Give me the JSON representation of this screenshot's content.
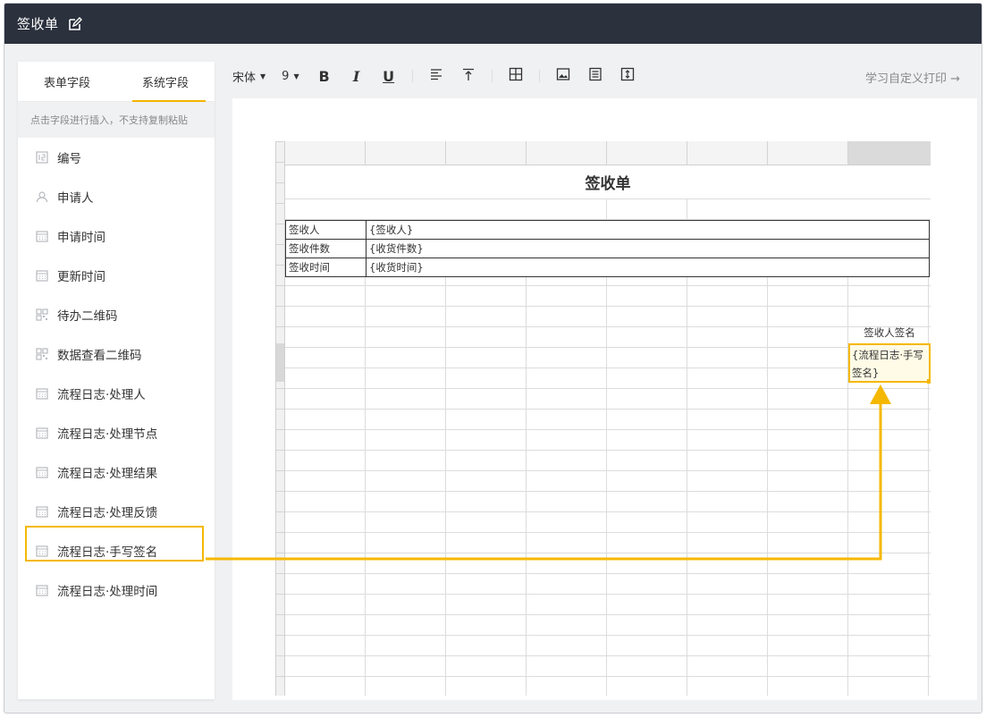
{
  "window": {
    "title": "签收单"
  },
  "sidebar": {
    "tabs": [
      {
        "label": "表单字段",
        "active": false
      },
      {
        "label": "系统字段",
        "active": true
      }
    ],
    "hint": "点击字段进行插入，不支持复制粘贴",
    "items": [
      {
        "label": "编号",
        "icon": "number-icon"
      },
      {
        "label": "申请人",
        "icon": "user-icon"
      },
      {
        "label": "申请时间",
        "icon": "calendar-icon"
      },
      {
        "label": "更新时间",
        "icon": "calendar-icon"
      },
      {
        "label": "待办二维码",
        "icon": "qrcode-icon"
      },
      {
        "label": "数据查看二维码",
        "icon": "qrcode-icon"
      },
      {
        "label": "流程日志·处理人",
        "icon": "calendar-icon"
      },
      {
        "label": "流程日志·处理节点",
        "icon": "calendar-icon"
      },
      {
        "label": "流程日志·处理结果",
        "icon": "calendar-icon"
      },
      {
        "label": "流程日志·处理反馈",
        "icon": "calendar-icon"
      },
      {
        "label": "流程日志·手写签名",
        "icon": "calendar-icon",
        "highlighted": true
      },
      {
        "label": "流程日志·处理时间",
        "icon": "calendar-icon"
      }
    ]
  },
  "toolbar": {
    "font_family": "宋体",
    "font_size": "9",
    "bold": "B",
    "italic": "I",
    "underline": "U",
    "learn_link": "学习自定义打印 →"
  },
  "sheet": {
    "title": "签收单",
    "rows": [
      {
        "label": "签收人",
        "value": "{签收人}"
      },
      {
        "label": "签收件数",
        "value": "{收货件数}"
      },
      {
        "label": "签收时间",
        "value": "{收货时间}"
      }
    ],
    "signature_label": "签收人签名",
    "signature_value": "{流程日志·手写签名}"
  },
  "colors": {
    "accent": "#f5b800",
    "titlebar": "#2b313d"
  }
}
